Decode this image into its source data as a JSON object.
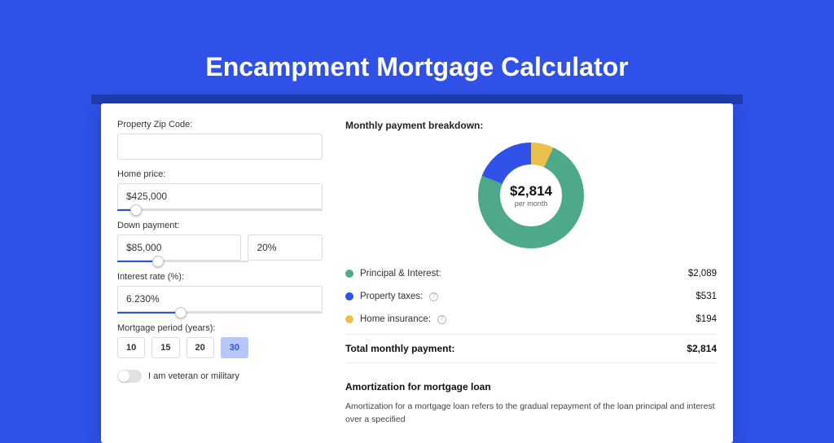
{
  "title": "Encampment Mortgage Calculator",
  "form": {
    "zip_label": "Property Zip Code:",
    "zip_value": "",
    "home_price_label": "Home price:",
    "home_price_value": "$425,000",
    "home_price_slider_pct": 9,
    "down_payment_label": "Down payment:",
    "down_payment_value": "$85,000",
    "down_payment_pct_value": "20%",
    "down_payment_slider_pct": 20,
    "interest_label": "Interest rate (%):",
    "interest_value": "6.230%",
    "interest_slider_pct": 31,
    "period_label": "Mortgage period (years):",
    "period_options": [
      "10",
      "15",
      "20",
      "30"
    ],
    "period_active": "30",
    "veteran_label": "I am veteran or military"
  },
  "breakdown": {
    "heading": "Monthly payment breakdown:",
    "center_value": "$2,814",
    "center_sub": "per month",
    "items": [
      {
        "label": "Principal & Interest:",
        "value": "$2,089",
        "dot": "green",
        "info": false
      },
      {
        "label": "Property taxes:",
        "value": "$531",
        "dot": "blue",
        "info": true
      },
      {
        "label": "Home insurance:",
        "value": "$194",
        "dot": "yellow",
        "info": true
      }
    ],
    "total_label": "Total monthly payment:",
    "total_value": "$2,814"
  },
  "amortization": {
    "heading": "Amortization for mortgage loan",
    "text": "Amortization for a mortgage loan refers to the gradual repayment of the loan principal and interest over a specified"
  },
  "chart_data": {
    "type": "pie",
    "title": "Monthly payment breakdown",
    "series": [
      {
        "name": "Principal & Interest",
        "value": 2089,
        "color": "#4ea98a"
      },
      {
        "name": "Property taxes",
        "value": 531,
        "color": "#2f51e8"
      },
      {
        "name": "Home insurance",
        "value": 194,
        "color": "#e8c04d"
      }
    ],
    "total": 2814
  }
}
